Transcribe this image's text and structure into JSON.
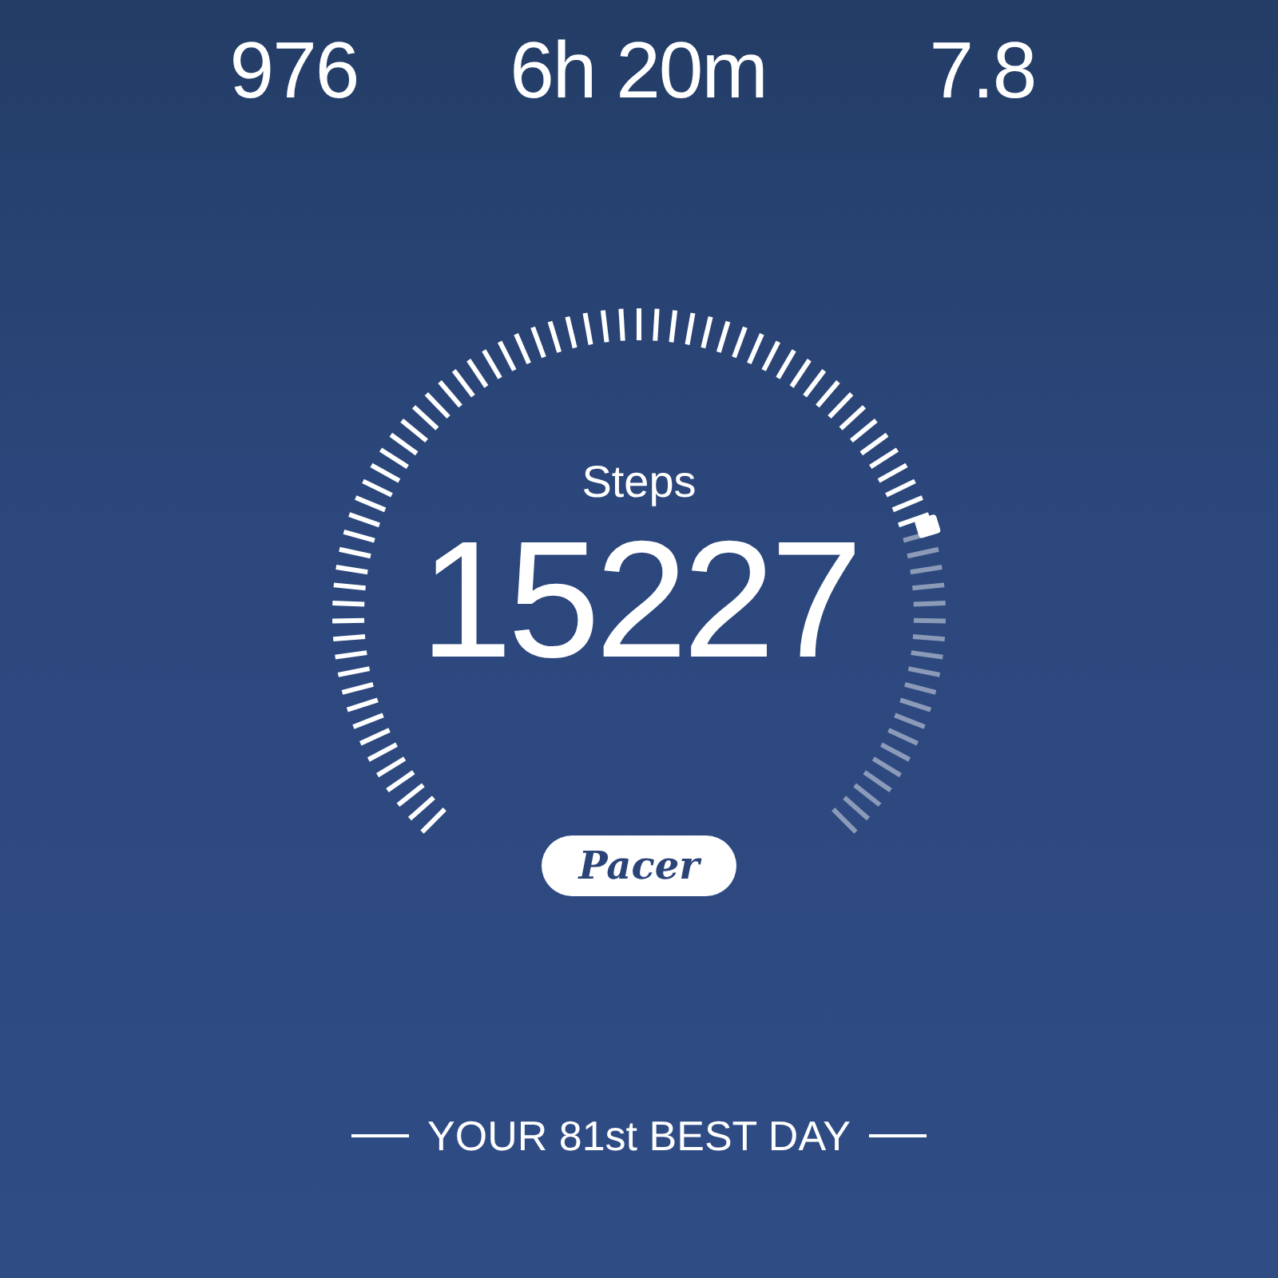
{
  "stats": [
    {
      "value": "976"
    },
    {
      "value": "6h 20m"
    },
    {
      "value": "7.8"
    }
  ],
  "gauge": {
    "label": "Steps",
    "value": "15227"
  },
  "logo": {
    "text": "Pacer"
  },
  "footer": {
    "text": "YOUR 81st BEST DAY"
  }
}
